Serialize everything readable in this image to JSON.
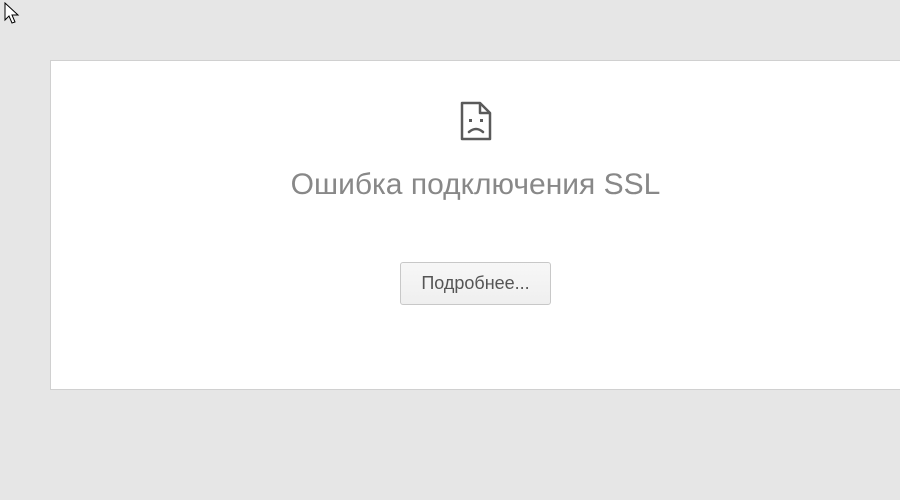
{
  "error": {
    "icon_name": "sad-page-icon",
    "title": "Ошибка подключения SSL",
    "details_button_label": "Подробнее..."
  }
}
